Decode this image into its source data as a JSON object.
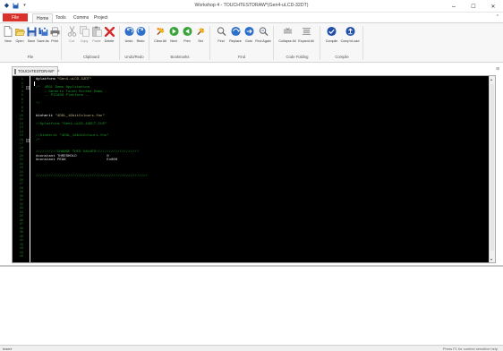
{
  "window": {
    "title": "Workshop 4 - TOUCHTESTDRAW*(Gen4-uLCD-32DT)",
    "controls": {
      "minimize": "–",
      "maximize": "☐",
      "close": "✕"
    }
  },
  "quick_access": [
    "app-icon",
    "save-icon",
    "dropdown-icon"
  ],
  "menu": {
    "file": "File",
    "tabs": [
      "Home",
      "Tools",
      "Comms",
      "Project"
    ],
    "active_tab": "Home"
  },
  "ribbon": {
    "buttons": [
      {
        "id": "new",
        "label": "New",
        "icon": "new-icon"
      },
      {
        "id": "open",
        "label": "Open",
        "icon": "open-icon"
      },
      {
        "id": "save",
        "label": "Save",
        "icon": "save-icon"
      },
      {
        "id": "saveas",
        "label": "Save As",
        "icon": "save-as-icon"
      },
      {
        "id": "print",
        "label": "Print",
        "icon": "print-icon"
      },
      {
        "id": "cut",
        "label": "Cut",
        "icon": "cut-icon"
      },
      {
        "id": "copy",
        "label": "Copy",
        "icon": "copy-icon"
      },
      {
        "id": "paste",
        "label": "Paste",
        "icon": "paste-icon"
      },
      {
        "id": "delete",
        "label": "Delete",
        "icon": "delete-icon"
      },
      {
        "id": "undo",
        "label": "Undo",
        "icon": "undo-icon"
      },
      {
        "id": "redo",
        "label": "Redo",
        "icon": "redo-icon"
      },
      {
        "id": "clearall",
        "label": "Clear All",
        "icon": "clear-bookmarks-icon"
      },
      {
        "id": "next",
        "label": "Next",
        "icon": "next-bookmark-icon"
      },
      {
        "id": "prev",
        "label": "Prev",
        "icon": "prev-bookmark-icon"
      },
      {
        "id": "set",
        "label": "Set",
        "icon": "set-bookmark-icon"
      },
      {
        "id": "find",
        "label": "Find",
        "icon": "find-icon"
      },
      {
        "id": "replace",
        "label": "Replace",
        "icon": "replace-icon"
      },
      {
        "id": "goto",
        "label": "Goto",
        "icon": "goto-icon"
      },
      {
        "id": "findagain",
        "label": "Find Again",
        "icon": "find-again-icon"
      },
      {
        "id": "collapseall",
        "label": "Collapse All",
        "icon": "collapse-all-icon"
      },
      {
        "id": "expandall",
        "label": "Expand All",
        "icon": "expand-all-icon"
      },
      {
        "id": "compile",
        "label": "Compile",
        "icon": "compile-icon"
      },
      {
        "id": "compload",
        "label": "Comp'nLoad",
        "icon": "compile-load-icon"
      }
    ],
    "groups": [
      "File",
      "Clipboard",
      "Undo/Redo",
      "Bookmarks",
      "Find",
      "Code Folding",
      "Compile"
    ]
  },
  "document_tab": {
    "name": "TOUCHTESTDRAW*",
    "close": "×"
  },
  "editor": {
    "lines": [
      {
        "n": "1",
        "text": "#platform \"Gen4-uLCD-32DT\"",
        "kind": "pre"
      },
      {
        "n": "2",
        "text": "",
        "kind": "pre"
      },
      {
        "n": "3",
        "text": "/*  4DGL Demo Application",
        "kind": "com"
      },
      {
        "n": "4",
        "text": "    - Generic Touch Screen Demo -",
        "kind": "com"
      },
      {
        "n": "5",
        "text": "    -- PICASO Platform --",
        "kind": "com"
      },
      {
        "n": "6",
        "text": "",
        "kind": "com"
      },
      {
        "n": "7",
        "text": "*/",
        "kind": "com"
      },
      {
        "n": "8",
        "text": "",
        "kind": "pre"
      },
      {
        "n": "9",
        "text": "",
        "kind": "pre"
      },
      {
        "n": "10",
        "text": "#inherit \"4DGL_16bitColours.fnc\"",
        "kind": "pre"
      },
      {
        "n": "11",
        "text": "",
        "kind": "pre"
      },
      {
        "n": "12",
        "text": "//#platform \"Gen4-uLCD-43DCT-CLB\"",
        "kind": "com"
      },
      {
        "n": "13",
        "text": "",
        "kind": "pre"
      },
      {
        "n": "14",
        "text": "",
        "kind": "pre"
      },
      {
        "n": "15",
        "text": "//#inherit \"4DGL_16bitColours.fnc\"",
        "kind": "com"
      },
      {
        "n": "16",
        "text": "/*",
        "kind": "com"
      },
      {
        "n": "17",
        "text": "",
        "kind": "pre"
      },
      {
        "n": "18",
        "text": "",
        "kind": "pre"
      },
      {
        "n": "19",
        "text": "//////////CHANGE THIS VALUES////////////////////",
        "kind": "com"
      },
      {
        "n": "20",
        "text": "#constant THRESHOLD              0",
        "kind": "kw"
      },
      {
        "n": "21",
        "text": "#constant PEAK                   Ex000",
        "kind": "kw"
      },
      {
        "n": "22",
        "text": "",
        "kind": "pre"
      },
      {
        "n": "23",
        "text": "",
        "kind": "pre"
      },
      {
        "n": "24",
        "text": "",
        "kind": "pre"
      },
      {
        "n": "25",
        "text": "////////////////////////////////////////////////////",
        "kind": "com"
      },
      {
        "n": "26",
        "text": "",
        "kind": "pre"
      },
      {
        "n": "27",
        "text": "",
        "kind": "pre"
      },
      {
        "n": "28",
        "text": "",
        "kind": "pre"
      },
      {
        "n": "29",
        "text": "",
        "kind": "pre"
      },
      {
        "n": "30",
        "text": "",
        "kind": "pre"
      },
      {
        "n": "31",
        "text": "",
        "kind": "pre"
      },
      {
        "n": "32",
        "text": "",
        "kind": "pre"
      },
      {
        "n": "33",
        "text": "",
        "kind": "pre"
      },
      {
        "n": "34",
        "text": "",
        "kind": "pre"
      },
      {
        "n": "35",
        "text": "",
        "kind": "pre"
      },
      {
        "n": "36",
        "text": "",
        "kind": "pre"
      },
      {
        "n": "37",
        "text": "",
        "kind": "pre"
      },
      {
        "n": "38",
        "text": "",
        "kind": "pre"
      },
      {
        "n": "39",
        "text": "",
        "kind": "pre"
      },
      {
        "n": "40",
        "text": "",
        "kind": "pre"
      },
      {
        "n": "41",
        "text": "",
        "kind": "pre"
      },
      {
        "n": "42",
        "text": "",
        "kind": "pre"
      },
      {
        "n": "43",
        "text": "",
        "kind": "pre"
      },
      {
        "n": "44",
        "text": "",
        "kind": "pre"
      },
      {
        "n": "45",
        "text": "",
        "kind": "pre"
      }
    ]
  },
  "status": {
    "mode": "Insert",
    "hint": "Press F1 for context sensitive help"
  },
  "colors": {
    "file_tab": "#d9322b",
    "editor_bg": "#000000",
    "comment": "#1fa02a",
    "string": "#c7bc86"
  }
}
